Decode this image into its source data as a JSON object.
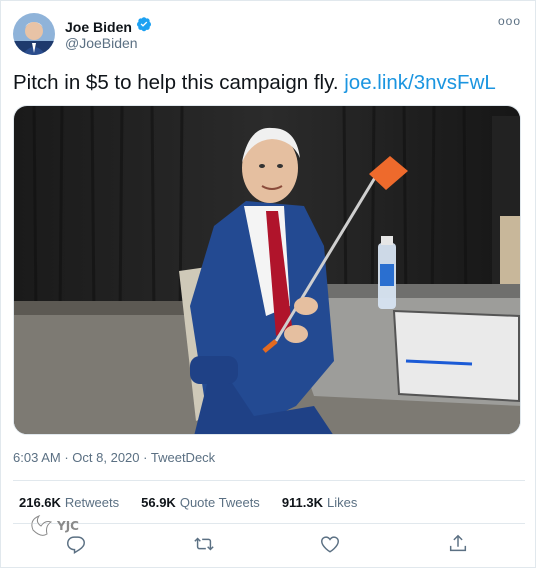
{
  "author": {
    "name": "Joe Biden",
    "handle": "@JoeBiden",
    "verified_icon": "verified-badge-icon"
  },
  "menu": {
    "label": "ooo"
  },
  "tweet": {
    "text": "Pitch in $5 to help this campaign fly.",
    "link": "joe.link/3nvsFwL"
  },
  "meta": {
    "time": "6:03 AM",
    "date": "Oct 8, 2020",
    "source": "TweetDeck",
    "separator": "·"
  },
  "stats": {
    "retweets_count": "216.6K",
    "retweets_label": "Retweets",
    "quote_count": "56.9K",
    "quote_label": "Quote Tweets",
    "likes_count": "911.3K",
    "likes_label": "Likes"
  },
  "watermark": {
    "text": "YJC"
  },
  "colors": {
    "link": "#1b95e0",
    "verified": "#1da1f2",
    "muted": "#5b7083"
  }
}
